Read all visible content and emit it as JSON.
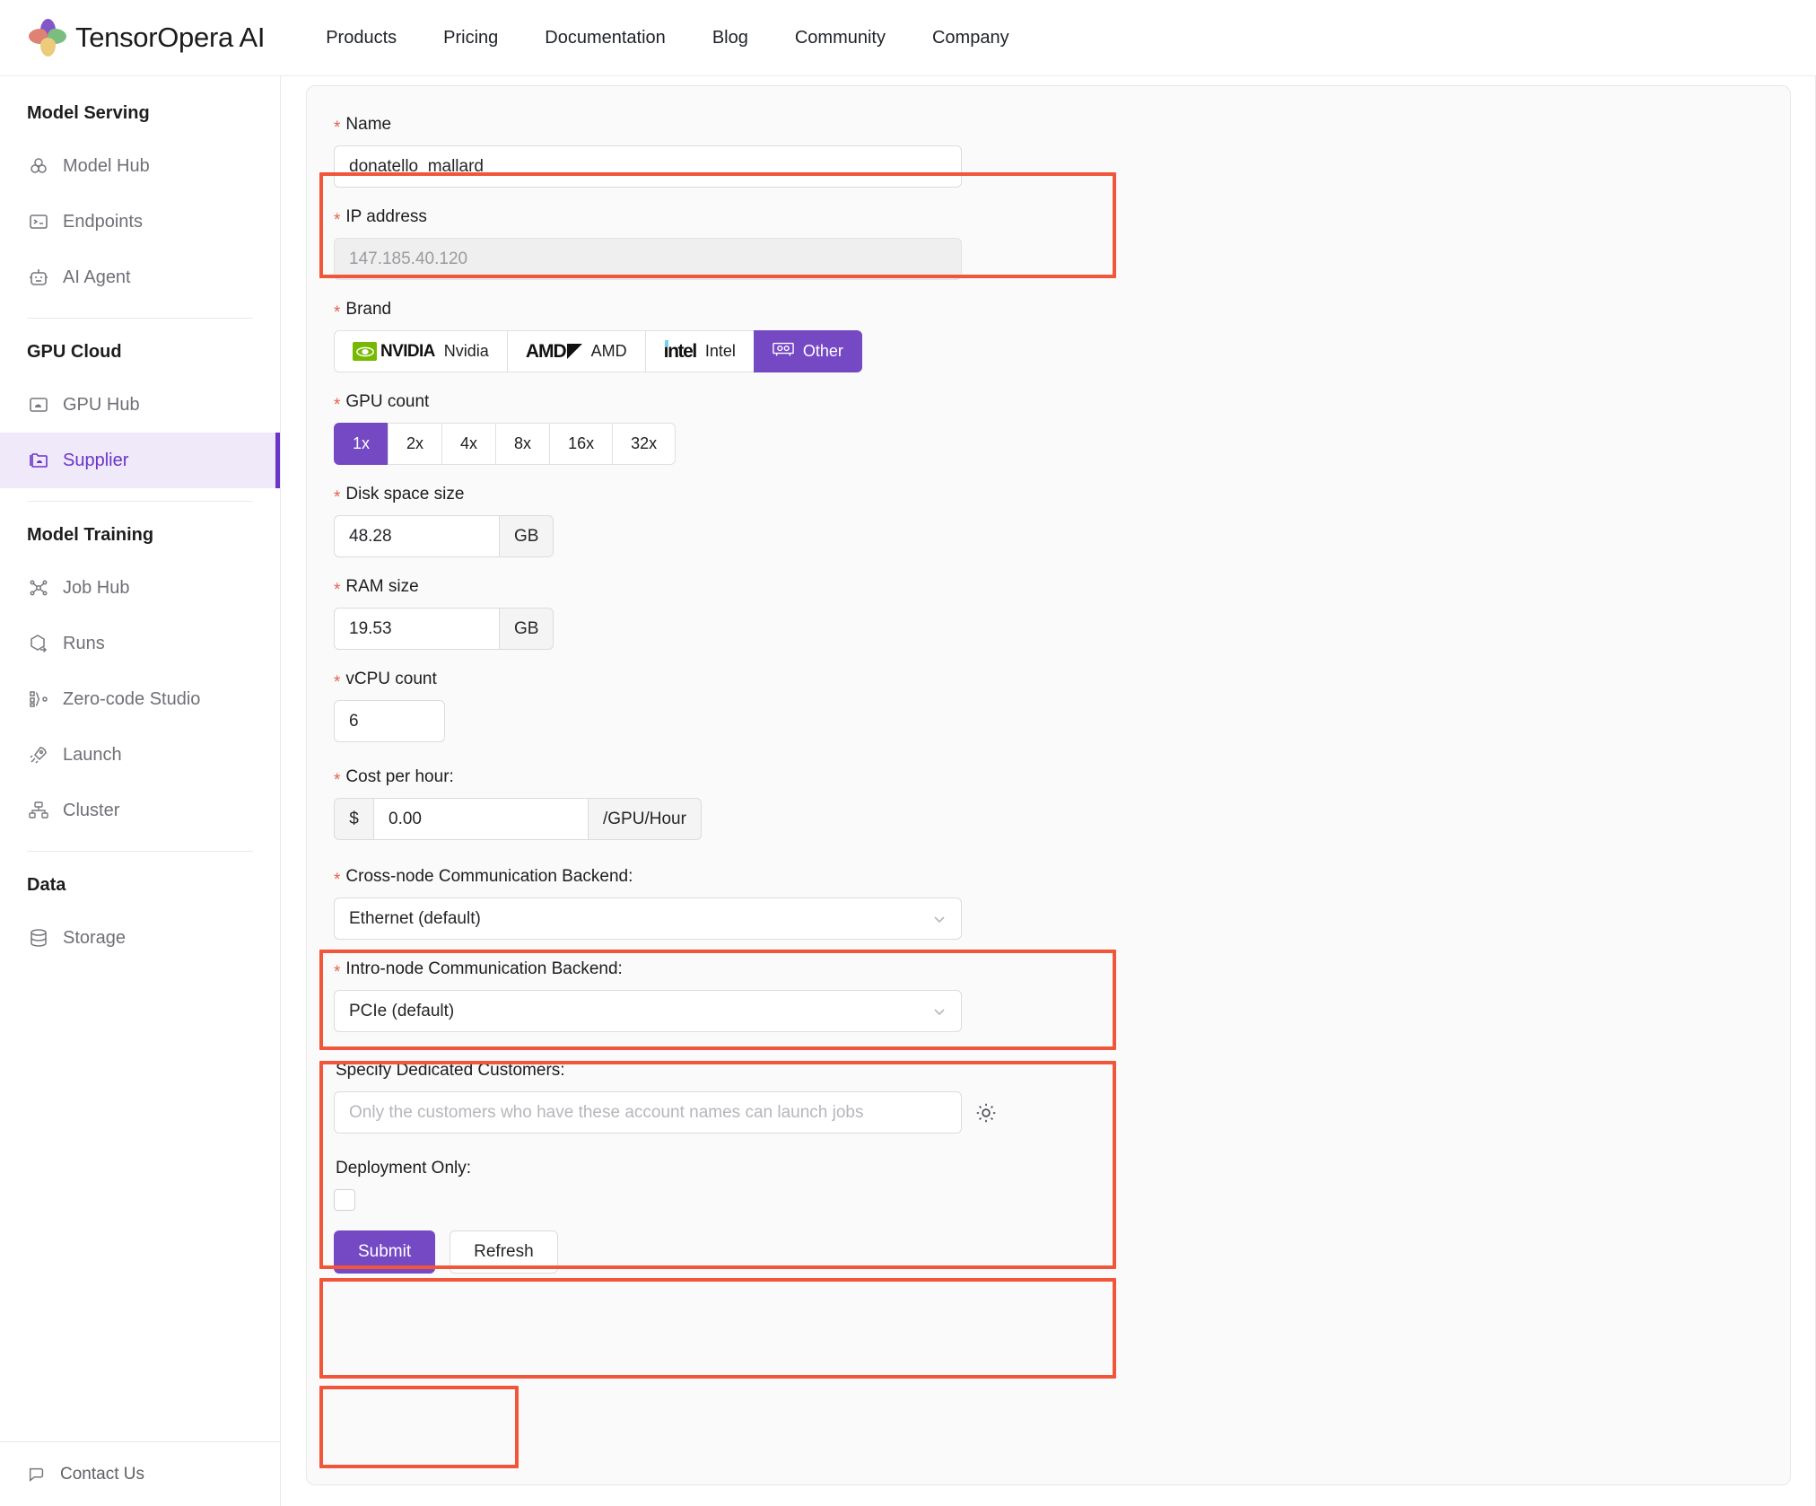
{
  "header": {
    "logo_icon": "tensoropera-flower-logo",
    "brand": "TensorOpera AI",
    "nav": [
      {
        "label": "Products"
      },
      {
        "label": "Pricing"
      },
      {
        "label": "Documentation"
      },
      {
        "label": "Blog"
      },
      {
        "label": "Community"
      },
      {
        "label": "Company"
      }
    ]
  },
  "sidebar": {
    "groups": [
      {
        "title": "Model Serving",
        "items": [
          {
            "label": "Model Hub",
            "icon": "cubes-icon",
            "active": false
          },
          {
            "label": "Endpoints",
            "icon": "terminal-icon",
            "active": false
          },
          {
            "label": "AI Agent",
            "icon": "robot-icon",
            "active": false
          }
        ]
      },
      {
        "title": "GPU Cloud",
        "items": [
          {
            "label": "GPU Hub",
            "icon": "gpu-cloud-icon",
            "active": false
          },
          {
            "label": "Supplier",
            "icon": "folders-icon",
            "active": true
          }
        ]
      },
      {
        "title": "Model Training",
        "items": [
          {
            "label": "Job Hub",
            "icon": "nodes-icon",
            "active": false
          },
          {
            "label": "Runs",
            "icon": "cube-arrow-icon",
            "active": false
          },
          {
            "label": "Zero-code Studio",
            "icon": "flow-icon",
            "active": false
          },
          {
            "label": "Launch",
            "icon": "rocket-icon",
            "active": false
          },
          {
            "label": "Cluster",
            "icon": "cluster-icon",
            "active": false
          }
        ]
      },
      {
        "title": "Data",
        "items": [
          {
            "label": "Storage",
            "icon": "database-icon",
            "active": false
          }
        ]
      }
    ],
    "footer": {
      "label": "Contact Us",
      "icon": "chat-icon"
    }
  },
  "form": {
    "name": {
      "label": "Name",
      "required": true,
      "value": "donatello_mallard",
      "highlighted": true
    },
    "ip_address": {
      "label": "IP address",
      "required": true,
      "value": "147.185.40.120",
      "disabled": true
    },
    "brand": {
      "label": "Brand",
      "required": true,
      "options": [
        {
          "label": "Nvidia",
          "logo": "nvidia-logo",
          "selected": false
        },
        {
          "label": "AMD",
          "logo": "amd-logo",
          "selected": false
        },
        {
          "label": "Intel",
          "logo": "intel-logo",
          "selected": false
        },
        {
          "label": "Other",
          "logo": "gpu-card-icon",
          "selected": true
        }
      ]
    },
    "gpu_count": {
      "label": "GPU count",
      "required": true,
      "options": [
        "1x",
        "2x",
        "4x",
        "8x",
        "16x",
        "32x"
      ],
      "selected": "1x"
    },
    "disk_space": {
      "label": "Disk space size",
      "required": true,
      "value": "48.28",
      "unit": "GB"
    },
    "ram_size": {
      "label": "RAM size",
      "required": true,
      "value": "19.53",
      "unit": "GB"
    },
    "vcpu_count": {
      "label": "vCPU count",
      "required": true,
      "value": "6"
    },
    "cost_per_hour": {
      "label": "Cost per hour:",
      "required": true,
      "currency": "$",
      "value": "0.00",
      "suffix": "/GPU/Hour",
      "highlighted": true
    },
    "cross_node_backend": {
      "label": "Cross-node Communication Backend:",
      "required": true,
      "value": "Ethernet (default)",
      "highlighted": true
    },
    "intro_node_backend": {
      "label": "Intro-node Communication Backend:",
      "required": true,
      "value": "PCIe (default)",
      "highlighted": true
    },
    "dedicated_customers": {
      "label": "Specify Dedicated Customers:",
      "required": false,
      "value": "",
      "placeholder": "Only the customers who have these account names can launch jobs",
      "trailing_icon": "sun-icon",
      "highlighted": true
    },
    "deployment_only": {
      "label": "Deployment Only:",
      "checked": false,
      "highlighted": true
    },
    "buttons": {
      "submit": "Submit",
      "refresh": "Refresh"
    }
  },
  "colors": {
    "accent_purple": "#7549c4",
    "active_sidebar_bg": "#efe9fa",
    "annotation_red": "#f1563a",
    "required_star": "#e8604c",
    "nvidia_green": "#76b900",
    "intel_blue": "#6fd3f2"
  }
}
